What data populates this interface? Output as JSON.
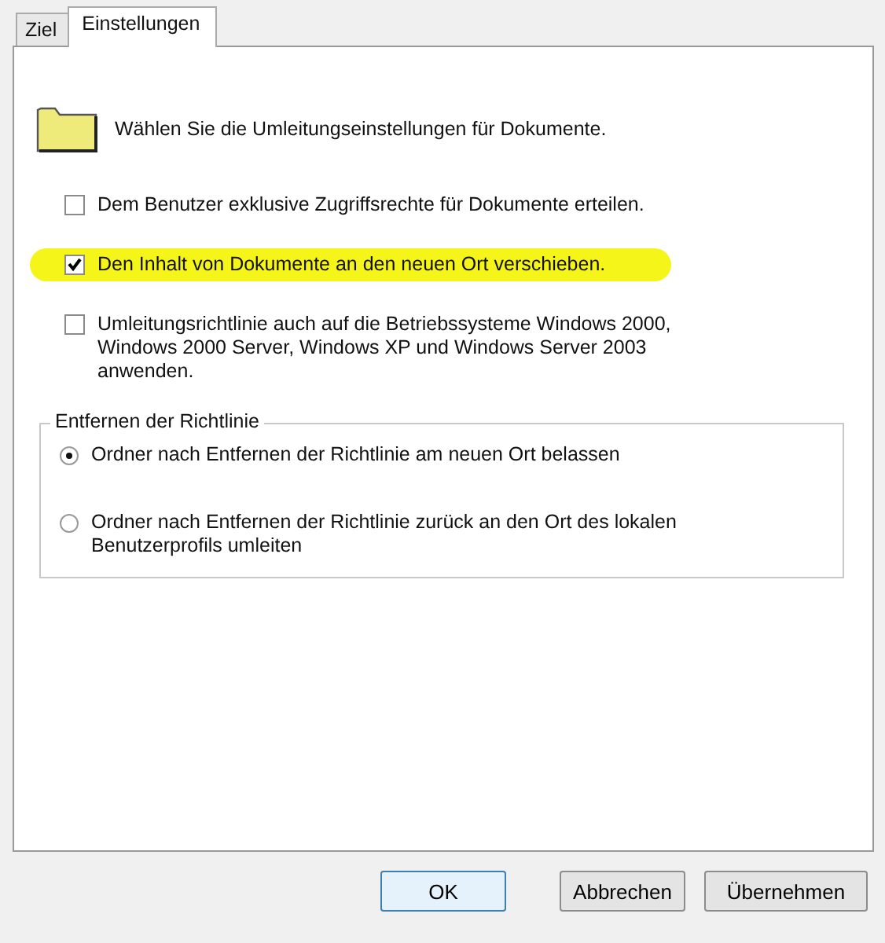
{
  "tabs": [
    {
      "label": "Ziel",
      "selected": false
    },
    {
      "label": "Einstellungen",
      "selected": true
    }
  ],
  "heading": "Wählen Sie die Umleitungseinstellungen für Dokumente.",
  "checkboxes": [
    {
      "label": "Dem Benutzer exklusive Zugriffsrechte für Dokumente erteilen.",
      "checked": false,
      "highlighted": false
    },
    {
      "label": "Den Inhalt von Dokumente an den neuen Ort verschieben.",
      "checked": true,
      "highlighted": true
    },
    {
      "label": "Umleitungsrichtlinie auch auf die Betriebssysteme Windows 2000, Windows 2000 Server, Windows XP und Windows Server 2003 anwenden.",
      "checked": false,
      "highlighted": false
    }
  ],
  "group": {
    "title": "Entfernen der Richtlinie",
    "options": [
      {
        "label": "Ordner nach Entfernen der Richtlinie am neuen Ort belassen",
        "selected": true
      },
      {
        "label": "Ordner nach Entfernen der Richtlinie zurück an den Ort des lokalen Benutzerprofils umleiten",
        "selected": false
      }
    ]
  },
  "buttons": [
    {
      "label": "OK",
      "default": true
    },
    {
      "label": "Abbrechen",
      "default": false
    },
    {
      "label": "Übernehmen",
      "default": false
    }
  ]
}
